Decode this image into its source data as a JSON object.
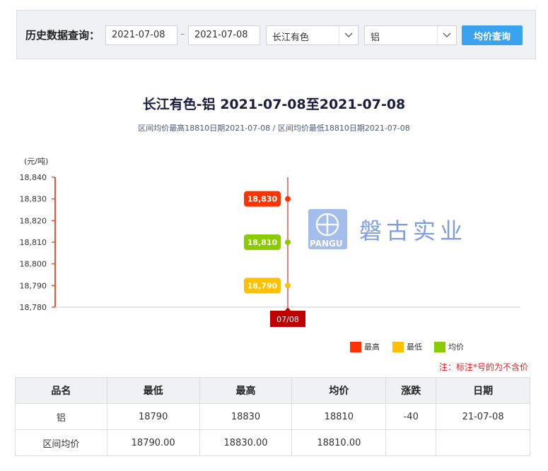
{
  "query": {
    "label": "历史数据查询：",
    "start_date": "2021-07-08",
    "end_date": "2021-07-08",
    "separator": "–",
    "market": "长江有色",
    "metal": "铝",
    "button": "均价查询"
  },
  "chart_data": {
    "type": "line",
    "title": "长江有色-铝 2021-07-08至2021-07-08",
    "subtitle": "区间均价最高18810日期2021-07-08 / 区间均价最低18810日期2021-07-08",
    "ylabel": "(元/吨)",
    "ylim": [
      18780,
      18840
    ],
    "yticks": [
      "18,780",
      "18,790",
      "18,800",
      "18,810",
      "18,820",
      "18,830",
      "18,840"
    ],
    "categories": [
      "07/08"
    ],
    "series": [
      {
        "name": "最高",
        "color": "#ff3300",
        "values": [
          18830
        ],
        "label": "18,830"
      },
      {
        "name": "最低",
        "color": "#ffc000",
        "values": [
          18790
        ],
        "label": "18,790"
      },
      {
        "name": "均价",
        "color": "#88cc00",
        "values": [
          18810
        ],
        "label": "18,810"
      }
    ],
    "legend_position": "bottom-right",
    "grid": false
  },
  "watermark": {
    "logo_text": "PANGU",
    "company": "磐古实业"
  },
  "note": "注：标注*号的为不含价",
  "table": {
    "headers": [
      "品名",
      "最低",
      "最高",
      "均价",
      "涨跌",
      "日期"
    ],
    "rows": [
      [
        "铝",
        "18790",
        "18830",
        "18810",
        "-40",
        "21-07-08"
      ],
      [
        "区间均价",
        "18790.00",
        "18830.00",
        "18810.00",
        "",
        ""
      ]
    ]
  }
}
